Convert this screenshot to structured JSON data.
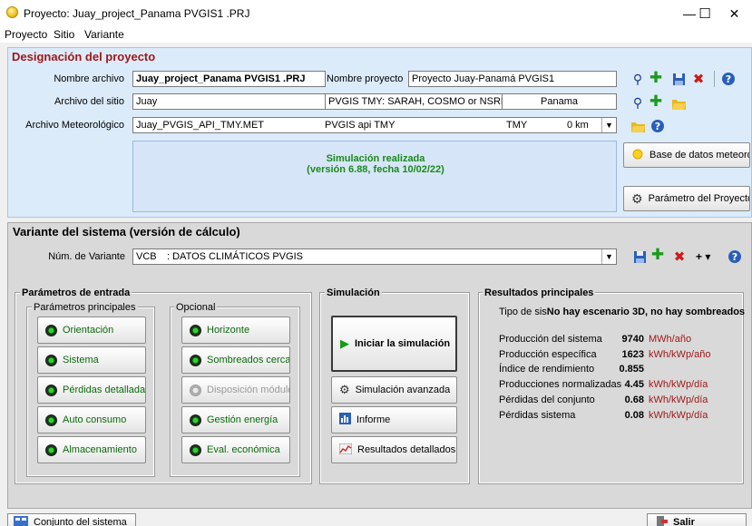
{
  "window": {
    "title": "Proyecto:  Juay_project_Panama PVGIS1 .PRJ",
    "min_glyph": "—",
    "max_glyph": "☐",
    "close_glyph": "✕"
  },
  "menu": [
    "Proyecto",
    "Sitio",
    "Variante"
  ],
  "project": {
    "header": "Designación del proyecto",
    "file_label": "Nombre archivo",
    "file_value": "Juay_project_Panama PVGIS1 .PRJ",
    "project_name_label": "Nombre proyecto",
    "project_name_value": "Proyecto Juay-Panamá PVGIS1",
    "site_label": "Archivo del sitio",
    "site_value": "Juay",
    "site_source": "PVGIS TMY: SARAH, COSMO or NSRDB",
    "site_country": "Panama",
    "meteo_label": "Archivo Meteorológico",
    "meteo_value": "Juay_PVGIS_API_TMY.MET",
    "meteo_source": "PVGIS api TMY",
    "meteo_type": "TMY",
    "meteo_distance": "0 km",
    "sim_status_line1": "Simulación realizada",
    "sim_status_line2": "(versión 6.88, fecha 10/02/22)",
    "btn_meteo_db": "Base de datos meteorológicos",
    "btn_project_params": "Parámetro del Proyecto"
  },
  "variant": {
    "header": "Variante del sistema (versión de cálculo)",
    "num_label": "Núm. de Variante",
    "num_value": "VCB",
    "num_desc": ": DATOS CLIMÁTICOS PVGIS",
    "plus_label": "+ ▾"
  },
  "inputs": {
    "title": "Parámetros de entrada",
    "main_title": "Parámetros principales",
    "optional_title": "Opcional",
    "main_buttons": [
      "Orientación",
      "Sistema",
      "Pérdidas detalladas",
      "Auto consumo",
      "Almacenamiento"
    ],
    "optional_buttons": [
      "Horizonte",
      "Sombreados cercanos",
      "Disposición módulo",
      "Gestión energía",
      "Eval. económica"
    ]
  },
  "simulation": {
    "title": "Simulación",
    "run": "Iniciar la simulación",
    "advanced": "Simulación avanzada",
    "report": "Informe",
    "detailed": "Resultados detallados"
  },
  "results": {
    "title": "Resultados principales",
    "type_prefix": "Tipo de sis",
    "type_bold": "No hay escenario 3D, no hay sombreados",
    "rows": [
      {
        "label": "Producción del sistema",
        "value": "9740",
        "unit": "MWh/año"
      },
      {
        "label": "Producción específica",
        "value": "1623",
        "unit": "kWh/kWp/año"
      },
      {
        "label": "Índice de rendimiento",
        "value": "0.855",
        "unit": ""
      },
      {
        "label": "Producciones normalizadas",
        "value": "4.45",
        "unit": "kWh/kWp/día"
      },
      {
        "label": "Pérdidas del conjunto",
        "value": "0.68",
        "unit": "kWh/kWp/día"
      },
      {
        "label": "Pérdidas sistema",
        "value": "0.08",
        "unit": "kWh/kWp/día"
      }
    ]
  },
  "footer": {
    "left_button": "Conjunto del sistema",
    "right_button": "Salir"
  }
}
